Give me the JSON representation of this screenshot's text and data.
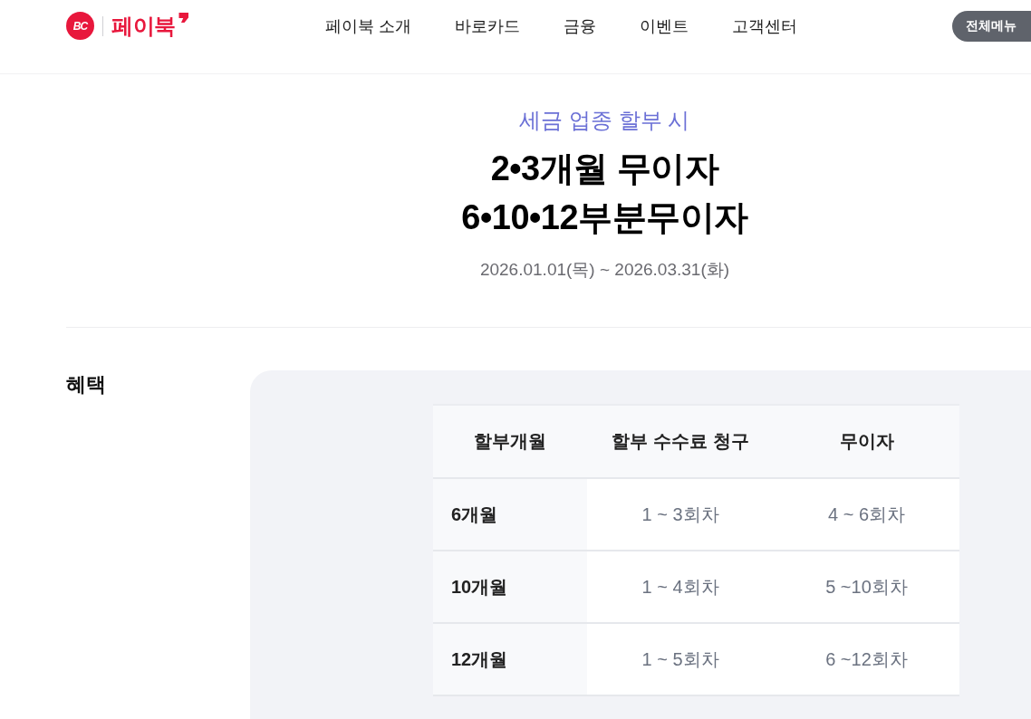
{
  "header": {
    "logo": {
      "mark": "BC",
      "name": "페이북"
    },
    "nav": [
      "페이북 소개",
      "바로카드",
      "금융",
      "이벤트",
      "고객센터"
    ],
    "menu_button": "전체메뉴"
  },
  "hero": {
    "subtitle": "세금 업종 할부 시",
    "title_lines": [
      "2•3개월 무이자",
      "6•10•12부분무이자"
    ],
    "period": "2026.01.01(목) ~ 2026.03.31(화)"
  },
  "benefit": {
    "heading": "혜택",
    "table": {
      "columns": [
        "할부개월",
        "할부 수수료 청구",
        "무이자"
      ],
      "rows": [
        [
          "6개월",
          "1 ~ 3회차",
          "4 ~ 6회차"
        ],
        [
          "10개월",
          "1 ~ 4회차",
          "5 ~10회차"
        ],
        [
          "12개월",
          "1 ~ 5회차",
          "6 ~12회차"
        ]
      ]
    }
  }
}
